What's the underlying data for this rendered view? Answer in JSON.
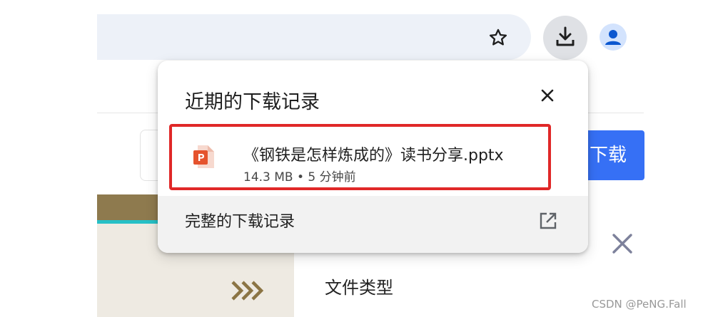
{
  "toolbar": {
    "bookmark_icon": "star-outline-icon",
    "download_icon": "download-icon",
    "profile_icon": "account-avatar-icon"
  },
  "page": {
    "download_button_label": "下载",
    "file_type_label": "文件类型",
    "watermark": "CSDN @PeNG.Fall"
  },
  "download_bubble": {
    "title": "近期的下载记录",
    "items": [
      {
        "file_name": "《钢铁是怎样炼成的》读书分享.pptx",
        "meta": "14.3 MB • 5 分钟前",
        "icon": "powerpoint-file-icon"
      }
    ],
    "full_history_label": "完整的下载记录"
  },
  "colors": {
    "highlight_border": "#e02828",
    "page_button": "#3670f5",
    "ppt_orange": "#e5532d",
    "avatar_blue": "#0b57d0"
  }
}
